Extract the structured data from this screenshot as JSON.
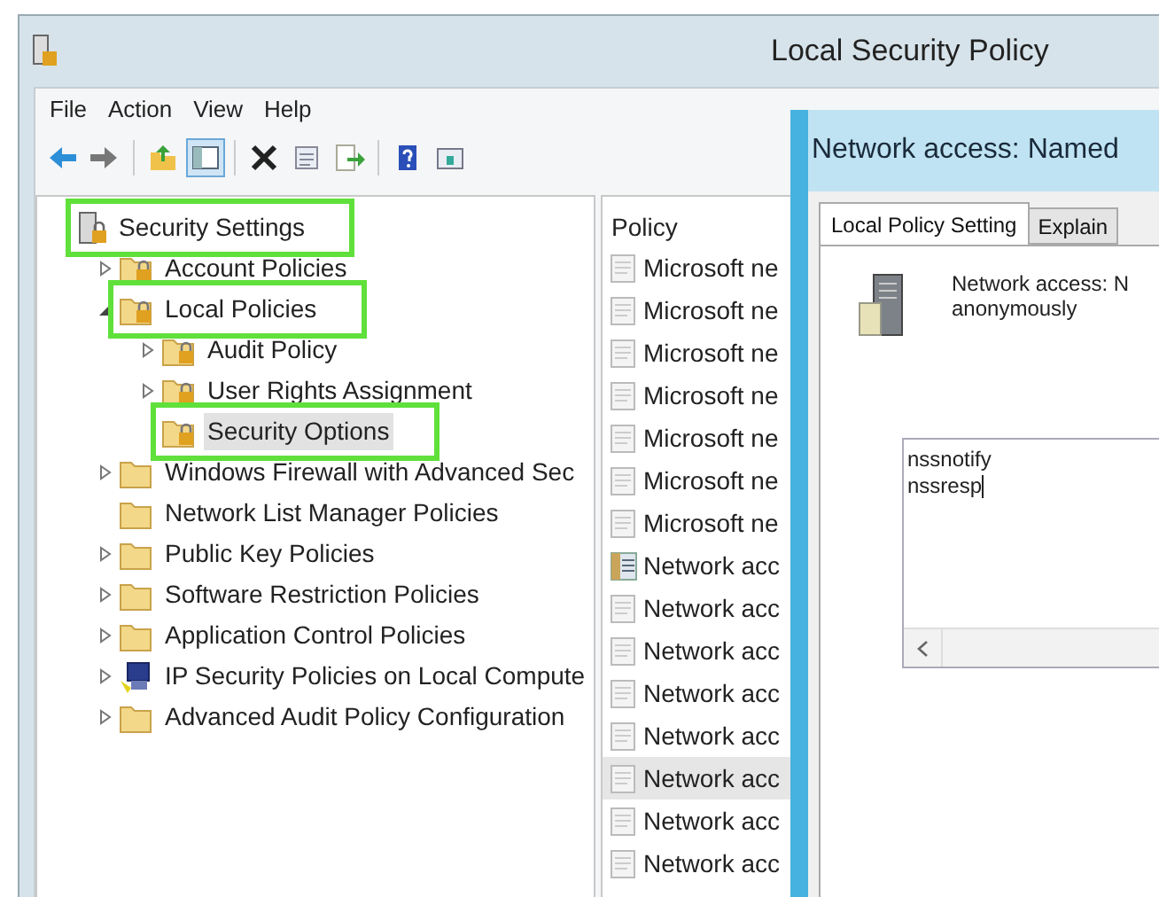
{
  "window": {
    "title": "Local Security Policy"
  },
  "menu": [
    "File",
    "Action",
    "View",
    "Help"
  ],
  "toolbar": [
    {
      "kind": "back",
      "pressed": false
    },
    {
      "kind": "forward",
      "pressed": false
    },
    {
      "kind": "up",
      "pressed": false
    },
    {
      "kind": "tree",
      "pressed": true
    },
    {
      "kind": "delete",
      "pressed": false
    },
    {
      "kind": "properties",
      "pressed": false
    },
    {
      "kind": "export",
      "pressed": false
    },
    {
      "kind": "help",
      "pressed": false
    },
    {
      "kind": "pane",
      "pressed": false
    }
  ],
  "tree": [
    {
      "label": "Security Settings",
      "kind": "root",
      "selected": false,
      "highlighted": true,
      "children": [
        {
          "label": "Account Policies",
          "kind": "policy-folder",
          "expandable": true,
          "expanded": false,
          "selected": false,
          "highlighted": false
        },
        {
          "label": "Local Policies",
          "kind": "policy-folder",
          "expandable": true,
          "expanded": true,
          "selected": false,
          "highlighted": true,
          "children": [
            {
              "label": "Audit Policy",
              "kind": "policy-folder",
              "expandable": true,
              "expanded": false,
              "selected": false,
              "highlighted": false
            },
            {
              "label": "User Rights Assignment",
              "kind": "policy-folder",
              "expandable": true,
              "expanded": false,
              "selected": false,
              "highlighted": false
            },
            {
              "label": "Security Options",
              "kind": "policy-folder",
              "expandable": false,
              "expanded": false,
              "selected": true,
              "highlighted": true
            }
          ]
        },
        {
          "label": "Windows Firewall with Advanced Sec",
          "kind": "folder",
          "expandable": true,
          "expanded": false,
          "selected": false,
          "highlighted": false
        },
        {
          "label": "Network List Manager Policies",
          "kind": "folder",
          "expandable": false,
          "expanded": false,
          "selected": false,
          "highlighted": false
        },
        {
          "label": "Public Key Policies",
          "kind": "folder",
          "expandable": true,
          "expanded": false,
          "selected": false,
          "highlighted": false
        },
        {
          "label": "Software Restriction Policies",
          "kind": "folder",
          "expandable": true,
          "expanded": false,
          "selected": false,
          "highlighted": false
        },
        {
          "label": "Application Control Policies",
          "kind": "folder",
          "expandable": true,
          "expanded": false,
          "selected": false,
          "highlighted": false
        },
        {
          "label": "IP Security Policies on Local Compute",
          "kind": "network",
          "expandable": true,
          "expanded": false,
          "selected": false,
          "highlighted": false
        },
        {
          "label": "Advanced Audit Policy Configuration",
          "kind": "folder",
          "expandable": true,
          "expanded": false,
          "selected": false,
          "highlighted": false
        }
      ]
    }
  ],
  "policy_list": {
    "column": "Policy",
    "rows": [
      {
        "text": "Microsoft ne",
        "kind": "setting",
        "selected": false
      },
      {
        "text": "Microsoft ne",
        "kind": "setting",
        "selected": false
      },
      {
        "text": "Microsoft ne",
        "kind": "setting",
        "selected": false
      },
      {
        "text": "Microsoft ne",
        "kind": "setting",
        "selected": false
      },
      {
        "text": "Microsoft ne",
        "kind": "setting",
        "selected": false
      },
      {
        "text": "Microsoft ne",
        "kind": "setting",
        "selected": false
      },
      {
        "text": "Microsoft ne",
        "kind": "setting",
        "selected": false
      },
      {
        "text": "Network acc",
        "kind": "list-setting",
        "selected": false
      },
      {
        "text": "Network acc",
        "kind": "setting",
        "selected": false
      },
      {
        "text": "Network acc",
        "kind": "setting",
        "selected": false
      },
      {
        "text": "Network acc",
        "kind": "setting",
        "selected": false
      },
      {
        "text": "Network acc",
        "kind": "setting",
        "selected": false
      },
      {
        "text": "Network acc",
        "kind": "setting",
        "selected": true
      },
      {
        "text": "Network acc",
        "kind": "setting",
        "selected": false
      },
      {
        "text": "Network acc",
        "kind": "setting",
        "selected": false
      }
    ]
  },
  "dialog": {
    "title": "Network access: Named",
    "tabs": [
      {
        "label": "Local Policy Setting",
        "selected": true
      },
      {
        "label": "Explain",
        "selected": false
      }
    ],
    "description_lines": [
      "Network access: N",
      "anonymously"
    ],
    "value_lines": [
      "nssnotify",
      "nssresp"
    ]
  }
}
